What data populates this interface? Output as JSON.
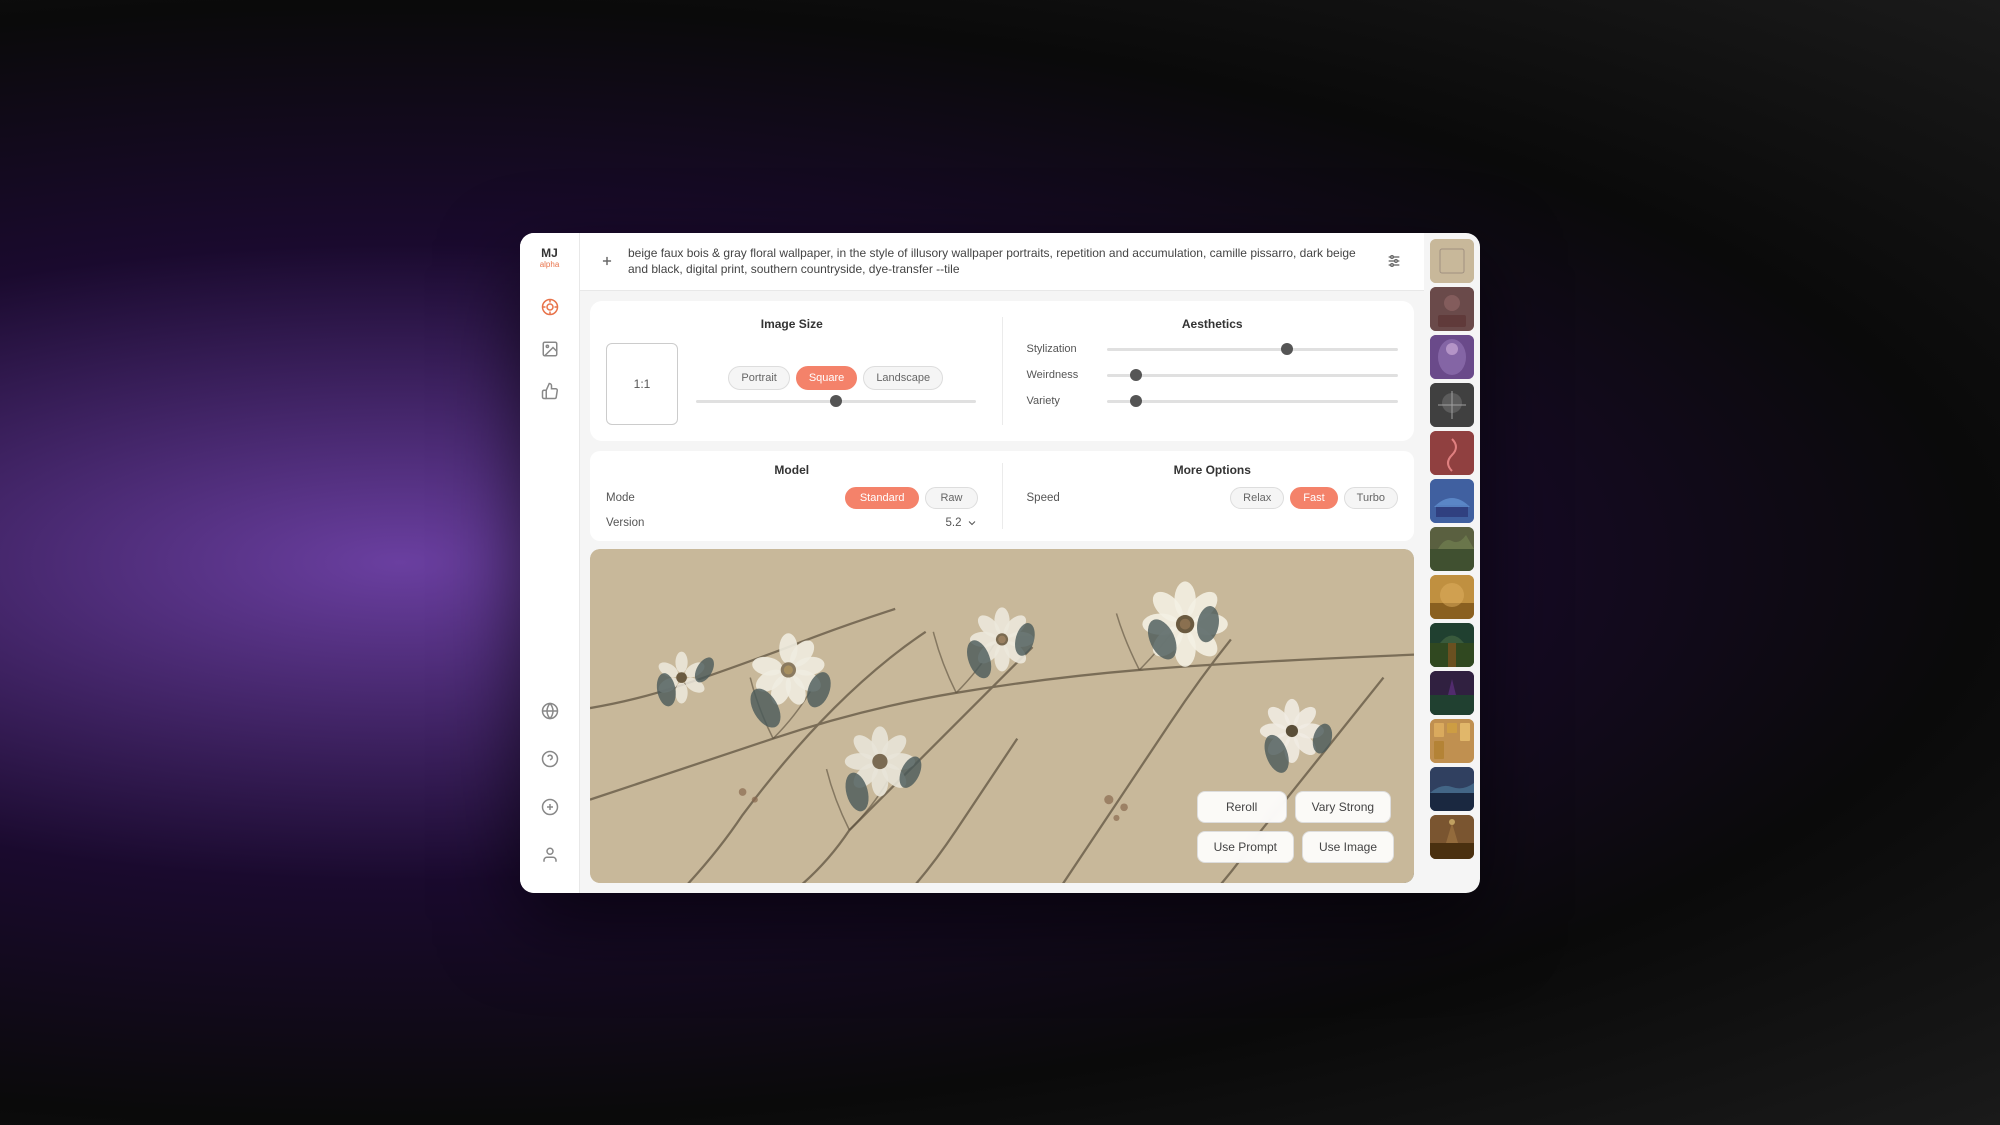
{
  "sidebar": {
    "logo": {
      "mj": "MJ",
      "alpha": "alpha"
    },
    "icons": [
      {
        "name": "target-icon",
        "symbol": "⊙",
        "active": true
      },
      {
        "name": "image-icon",
        "symbol": "▨",
        "active": false
      },
      {
        "name": "thumbsup-icon",
        "symbol": "👍",
        "active": false
      }
    ],
    "bottom_icons": [
      {
        "name": "globe-icon",
        "symbol": "🌐"
      },
      {
        "name": "help-icon",
        "symbol": "?"
      },
      {
        "name": "settings-icon",
        "symbol": "✳"
      },
      {
        "name": "profile-icon",
        "symbol": "👤"
      }
    ]
  },
  "prompt": {
    "text": "beige faux bois & gray floral wallpaper, in the style of illusory wallpaper portraits, repetition and accumulation, camille pissarro, dark beige and black, digital print, southern countryside, dye-transfer --tile",
    "add_label": "+",
    "settings_label": "⚙"
  },
  "image_size": {
    "title": "Image Size",
    "aspect_ratio": "1:1",
    "orientations": [
      "Portrait",
      "Square",
      "Landscape"
    ],
    "active_orientation": "Square"
  },
  "aesthetics": {
    "title": "Aesthetics",
    "stylization_label": "Stylization",
    "stylization_value": 65,
    "weirdness_label": "Weirdness",
    "weirdness_value": 10,
    "variety_label": "Variety",
    "variety_value": 10
  },
  "model": {
    "title": "Model",
    "mode_label": "Mode",
    "modes": [
      "Standard",
      "Raw"
    ],
    "active_mode": "Standard",
    "version_label": "Version",
    "version_value": "5.2"
  },
  "more_options": {
    "title": "More Options",
    "speed_label": "Speed",
    "speeds": [
      "Relax",
      "Fast",
      "Turbo"
    ],
    "active_speed": "Fast"
  },
  "actions": {
    "reroll_label": "Reroll",
    "vary_strong_label": "Vary Strong",
    "use_prompt_label": "Use Prompt",
    "use_image_label": "Use Image"
  },
  "colors": {
    "accent": "#f4826a",
    "active_bg": "#f4826a",
    "inactive_bg": "#f5f5f5",
    "panel_bg": "#ffffff",
    "window_bg": "#f5f5f5"
  }
}
